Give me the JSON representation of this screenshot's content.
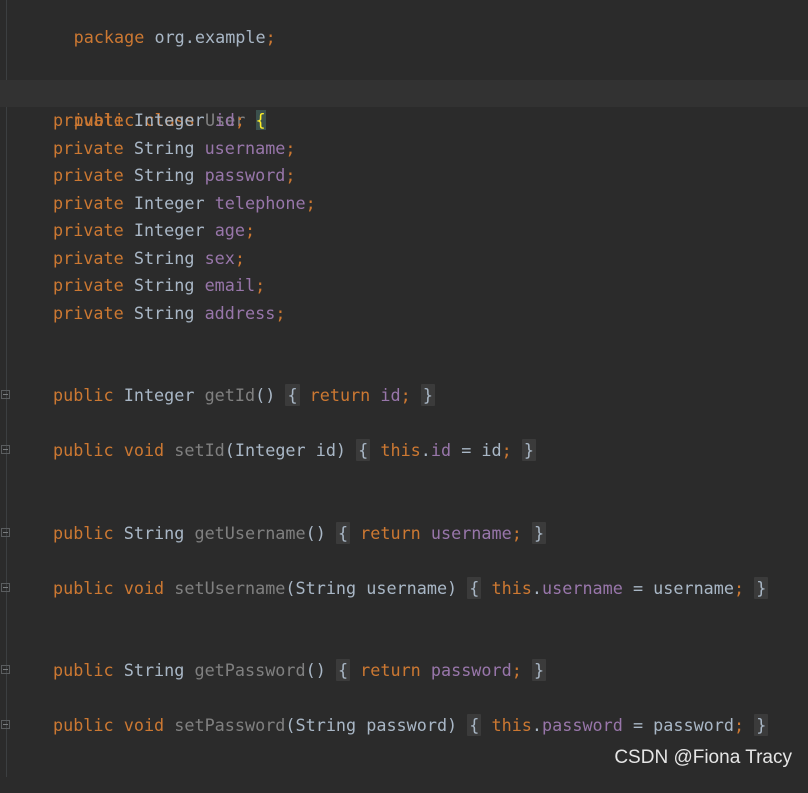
{
  "editor": {
    "pkg": {
      "kw": "package",
      "name": "org.example",
      "semi": ";"
    },
    "cls": {
      "kw1": "public",
      "kw2": "class",
      "name": "User",
      "brace": "{"
    },
    "fields": [
      {
        "kw": "private",
        "type": "Integer",
        "name": "id",
        "semi": ";"
      },
      {
        "kw": "private",
        "type": "String",
        "name": "username",
        "semi": ";"
      },
      {
        "kw": "private",
        "type": "String",
        "name": "password",
        "semi": ";"
      },
      {
        "kw": "private",
        "type": "Integer",
        "name": "telephone",
        "semi": ";"
      },
      {
        "kw": "private",
        "type": "Integer",
        "name": "age",
        "semi": ";"
      },
      {
        "kw": "private",
        "type": "String",
        "name": "sex",
        "semi": ";"
      },
      {
        "kw": "private",
        "type": "String",
        "name": "email",
        "semi": ";"
      },
      {
        "kw": "private",
        "type": "String",
        "name": "address",
        "semi": ";"
      }
    ],
    "getId": {
      "kw": "public",
      "type": "Integer",
      "name": "getId",
      "parens": "()",
      "open": "{",
      "ret": "return",
      "field": "id",
      "semi": ";",
      "close": "}"
    },
    "setId": {
      "kw": "public",
      "void": "void",
      "name": "setId",
      "params": "(Integer id)",
      "open": "{",
      "this": "this",
      "dot": ".",
      "field": "id",
      "assign": " = id",
      "semi": ";",
      "close": "}"
    },
    "getUsername": {
      "kw": "public",
      "type": "String",
      "name": "getUsername",
      "parens": "()",
      "open": "{",
      "ret": "return",
      "field": "username",
      "semi": ";",
      "close": "}"
    },
    "setUsername": {
      "kw": "public",
      "void": "void",
      "name": "setUsername",
      "params": "(String username)",
      "open": "{",
      "this": "this",
      "dot": ".",
      "field": "username",
      "assign": " = username",
      "semi": ";",
      "close": "}"
    },
    "getPassword": {
      "kw": "public",
      "type": "String",
      "name": "getPassword",
      "parens": "()",
      "open": "{",
      "ret": "return",
      "field": "password",
      "semi": ";",
      "close": "}"
    },
    "setPassword": {
      "kw": "public",
      "void": "void",
      "name": "setPassword",
      "params": "(String password)",
      "open": "{",
      "this": "this",
      "dot": ".",
      "field": "password",
      "assign": " = password",
      "semi": ";",
      "close": "}"
    }
  },
  "watermark": "CSDN @Fiona Tracy",
  "colors": {
    "background": "#2b2b2b",
    "keyword": "#cc7832",
    "field": "#9876aa",
    "text": "#a9b7c6",
    "method": "#808080"
  }
}
